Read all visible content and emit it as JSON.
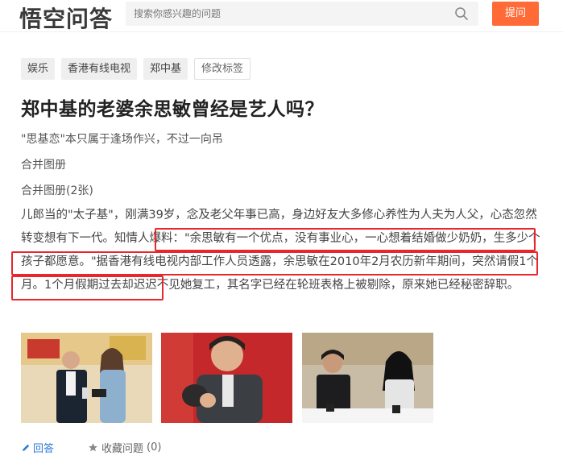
{
  "header": {
    "logo": "悟空问答",
    "search_placeholder": "搜索你感兴趣的问题",
    "ask_label": "提问"
  },
  "tags": [
    "娱乐",
    "香港有线电视",
    "郑中基"
  ],
  "edit_tags_label": "修改标签",
  "question_title": "郑中基的老婆余思敏曾经是艺人吗？",
  "answer": {
    "lead": "\"思基恋\"本只属于逢场作兴，不过一向吊",
    "merge_album_1": "合并图册",
    "merge_album_2": "合并图册(2张)",
    "para_part1": "儿郎当的\"太子基\"，刚满39岁，念及老父年事已高，身边好友大多修心养性为人夫为人父，心态忽然转变想有下一代。",
    "para_part2": "知情人爆料：\"余思敏有一个优点，没有事业心，一心想着结婚做少奶奶，生多少个孩子都愿意。\"据香港有线电视内部工作人员透露，余思敏在2010年2月农历新年期间，突然请假1个月。",
    "para_part3": "1个月假期过去却迟迟不见她复工，其名字已经在轮班表格上被剔除，原来她已经秘密辞职。"
  },
  "actions": {
    "answer_label": "回答",
    "collect_label": "收藏问题",
    "collect_count": "(0)"
  },
  "colors": {
    "accent": "#ff6a36",
    "highlight": "#e8262b",
    "link": "#2d7bd4"
  }
}
